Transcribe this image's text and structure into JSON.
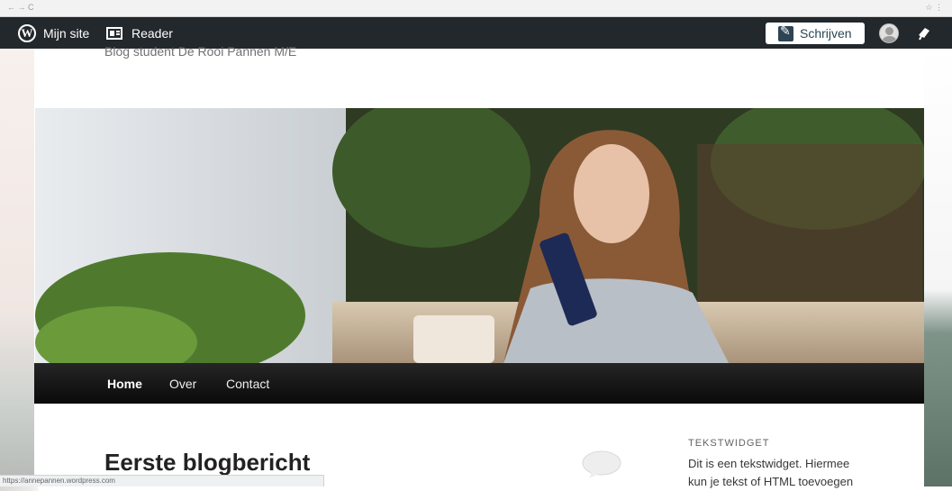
{
  "browser": {
    "url": "",
    "status_url": "https://annepannen.wordpress.com"
  },
  "adminbar": {
    "my_site_label": "Mijn site",
    "reader_label": "Reader",
    "write_label": "Schrijven",
    "icons": [
      "wordpress-icon",
      "reader-icon",
      "write-icon",
      "avatar",
      "bell-icon"
    ]
  },
  "site": {
    "tagline": "Blog student De Rooi Pannen M/E"
  },
  "nav": {
    "items": [
      {
        "label": "Home",
        "active": true
      },
      {
        "label": "Over",
        "active": false
      },
      {
        "label": "Contact",
        "active": false
      }
    ]
  },
  "post": {
    "title": "Eerste blogbericht"
  },
  "widget": {
    "title": "TEKSTWIDGET",
    "text": "Dit is een tekstwidget. Hiermee kun je tekst of HTML toevoegen"
  },
  "colors": {
    "adminbar_bg": "#23282d",
    "nav_bg": "#1a1a1a",
    "write_icon": "#2e4453"
  }
}
